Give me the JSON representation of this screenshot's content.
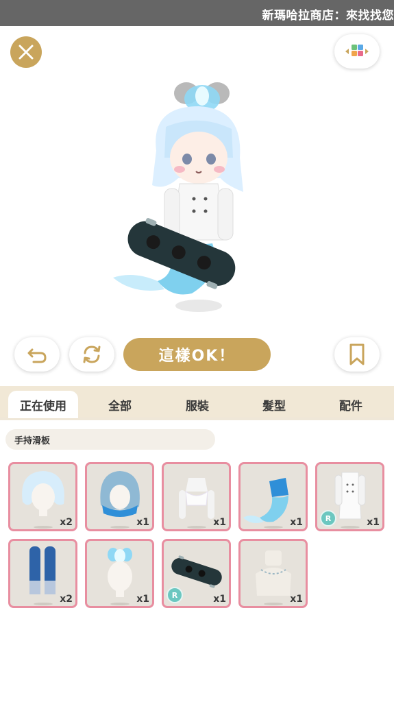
{
  "banner": {
    "text": "新瑪哈拉商店：來找找您"
  },
  "header": {
    "close_icon": "close-icon",
    "menu_icon": "color-grid-icon"
  },
  "actions": {
    "undo_icon": "undo-icon",
    "refresh_icon": "refresh-icon",
    "ok_label": "這樣OK！",
    "bookmark_icon": "bookmark-icon"
  },
  "tabs": [
    {
      "label": "正在使用",
      "active": true
    },
    {
      "label": "全部",
      "active": false
    },
    {
      "label": "服裝",
      "active": false
    },
    {
      "label": "髮型",
      "active": false
    },
    {
      "label": "配件",
      "active": false
    }
  ],
  "filter": {
    "label": "手持滑板"
  },
  "items": [
    {
      "name": "light-blue-bob-hair",
      "count": "x2",
      "badge": ""
    },
    {
      "name": "blue-gradient-hair",
      "count": "x1",
      "badge": ""
    },
    {
      "name": "white-crop-top",
      "count": "x1",
      "badge": ""
    },
    {
      "name": "mermaid-tail-outfit",
      "count": "x1",
      "badge": ""
    },
    {
      "name": "white-chef-coat",
      "count": "x1",
      "badge": "R"
    },
    {
      "name": "blue-gradient-leggings",
      "count": "x2",
      "badge": ""
    },
    {
      "name": "blue-flame-hair-accessory",
      "count": "x1",
      "badge": ""
    },
    {
      "name": "cat-skateboard",
      "count": "x1",
      "badge": "R"
    },
    {
      "name": "white-knit-turtleneck",
      "count": "x1",
      "badge": ""
    }
  ],
  "colors": {
    "gold": "#c9a55c",
    "item_border": "#e88ea0",
    "tab_bg": "#f1e8d6",
    "badge": "#6cc7c0"
  }
}
